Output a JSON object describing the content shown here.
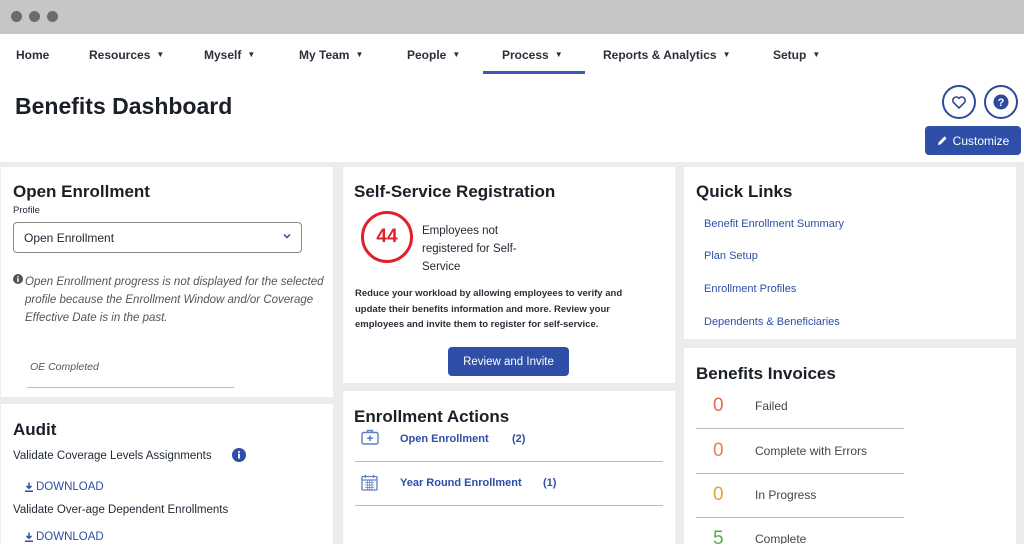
{
  "nav": {
    "items": [
      {
        "label": "Home",
        "caret": false
      },
      {
        "label": "Resources",
        "caret": true
      },
      {
        "label": "Myself",
        "caret": true
      },
      {
        "label": "My Team",
        "caret": true
      },
      {
        "label": "People",
        "caret": true
      },
      {
        "label": "Process",
        "caret": true,
        "active": true
      },
      {
        "label": "Reports & Analytics",
        "caret": true
      },
      {
        "label": "Setup",
        "caret": true
      }
    ]
  },
  "header": {
    "title": "Benefits Dashboard",
    "customize_label": "Customize"
  },
  "open_enrollment": {
    "title": "Open Enrollment",
    "profile_label": "Profile",
    "profile_value": "Open Enrollment",
    "note": "Open Enrollment progress is not displayed for the selected profile because the Enrollment Window and/or Coverage Effective Date is in the past.",
    "oe_completed_label": "OE Completed"
  },
  "audit": {
    "title": "Audit",
    "items": [
      {
        "label": "Validate Coverage Levels Assignments",
        "download": "DOWNLOAD"
      },
      {
        "label": "Validate Over-age Dependent Enrollments",
        "download": "DOWNLOAD"
      }
    ]
  },
  "self_service": {
    "title": "Self-Service Registration",
    "count": "44",
    "count_label": "Employees not registered for Self-Service",
    "description": "Reduce your workload by allowing employees to verify and update their benefits information and more. Review your employees and invite them to register for self-service.",
    "button_label": "Review and Invite"
  },
  "enrollment_actions": {
    "title": "Enrollment Actions",
    "items": [
      {
        "label": "Open Enrollment",
        "count": "(2)",
        "icon": "medical-kit-icon"
      },
      {
        "label": "Year Round Enrollment",
        "count": "(1)",
        "icon": "calendar-icon"
      }
    ]
  },
  "quick_links": {
    "title": "Quick Links",
    "items": [
      "Benefit Enrollment Summary",
      "Plan Setup",
      "Enrollment Profiles",
      "Dependents & Beneficiaries"
    ]
  },
  "benefits_invoices": {
    "title": "Benefits Invoices",
    "items": [
      {
        "count": "0",
        "label": "Failed",
        "color": "#e8694a"
      },
      {
        "count": "0",
        "label": "Complete with Errors",
        "color": "#e8824a"
      },
      {
        "count": "0",
        "label": "In Progress",
        "color": "#e6a235"
      },
      {
        "count": "5",
        "label": "Complete",
        "color": "#5aaa4a"
      }
    ]
  },
  "colors": {
    "primary": "#2e4ea7",
    "danger": "#e0202a"
  }
}
